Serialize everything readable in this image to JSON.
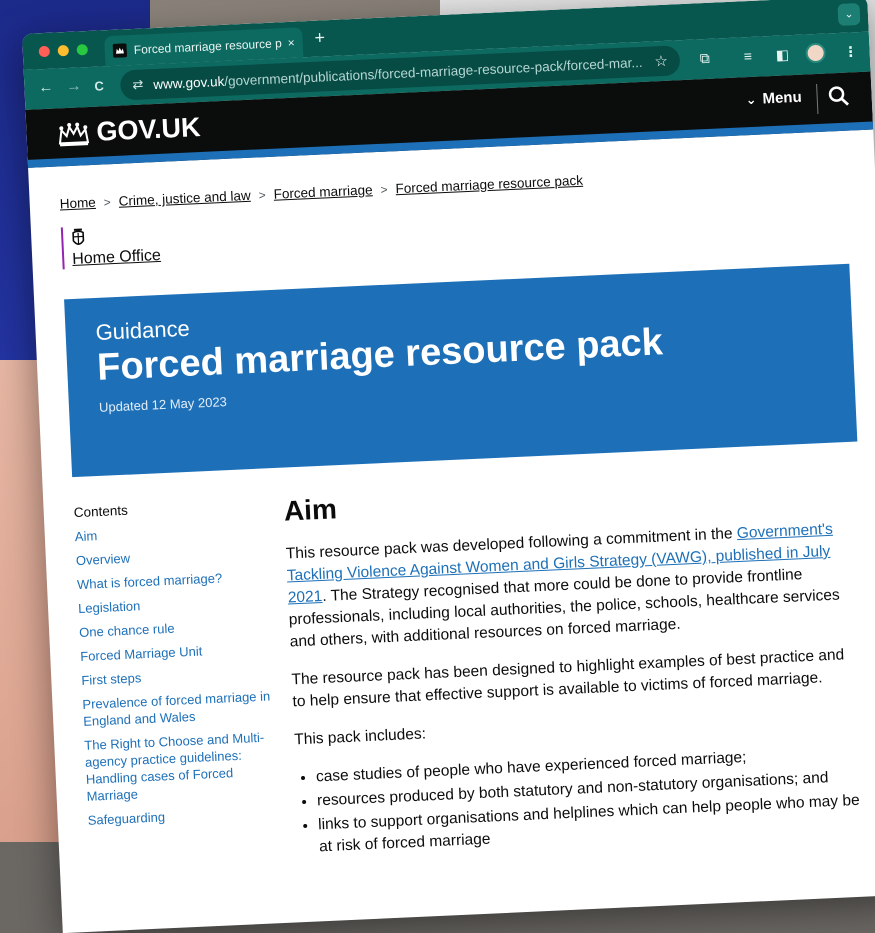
{
  "browser": {
    "tab_title": "Forced marriage resource pac",
    "tab_close": "×",
    "new_tab": "+",
    "tab_search": "⌄",
    "back": "←",
    "forward": "→",
    "reload": "C",
    "site_info": "⇄",
    "url_host": "www.gov.uk",
    "url_path": "/government/publications/forced-marriage-resource-pack/forced-mar...",
    "bookmark": "☆",
    "extensions": "⧉",
    "reading_list": "≡",
    "side_panel": "◧",
    "more": "⋮"
  },
  "header": {
    "logo_text": "GOV.UK",
    "menu_label": "Menu",
    "menu_chevron": "⌄"
  },
  "breadcrumb": {
    "items": [
      "Home",
      "Crime, justice and law",
      "Forced marriage",
      "Forced marriage resource pack"
    ],
    "sep": ">"
  },
  "organisation": {
    "name": "Home Office"
  },
  "hero": {
    "kicker": "Guidance",
    "title": "Forced marriage resource pack",
    "updated": "Updated 12 May 2023"
  },
  "contents": {
    "title": "Contents",
    "items": [
      "Aim",
      "Overview",
      "What is forced marriage?",
      "Legislation",
      "One chance rule",
      "Forced Marriage Unit",
      "First steps",
      "Prevalence of forced marriage in England and Wales",
      "The Right to Choose and Multi-agency practice guidelines: Handling cases of Forced Marriage",
      "Safeguarding"
    ]
  },
  "article": {
    "heading": "Aim",
    "p1_before": "This resource pack was developed following a commitment in the ",
    "p1_link": "Government's Tackling Violence Against Women and Girls Strategy (VAWG), published in July 2021",
    "p1_after": ". The Strategy recognised that more could be done to provide frontline professionals, including local authorities, the police, schools, healthcare services and others, with additional resources on forced marriage.",
    "p2": "The resource pack has been designed to highlight examples of best practice and to help ensure that effective support is available to victims of forced marriage.",
    "p3": "This pack includes:",
    "bullets": [
      "case studies of people who have experienced forced marriage;",
      "resources produced by both statutory and non-statutory organisations; and",
      "links to support organisations and helplines which can help people who may be at risk of forced marriage"
    ]
  },
  "colors": {
    "browser_frame": "#0d6a60",
    "gov_header": "#0b0c0c",
    "gov_blue": "#1d70b8",
    "link": "#1d70b8",
    "org_stripe": "#9325b2"
  }
}
